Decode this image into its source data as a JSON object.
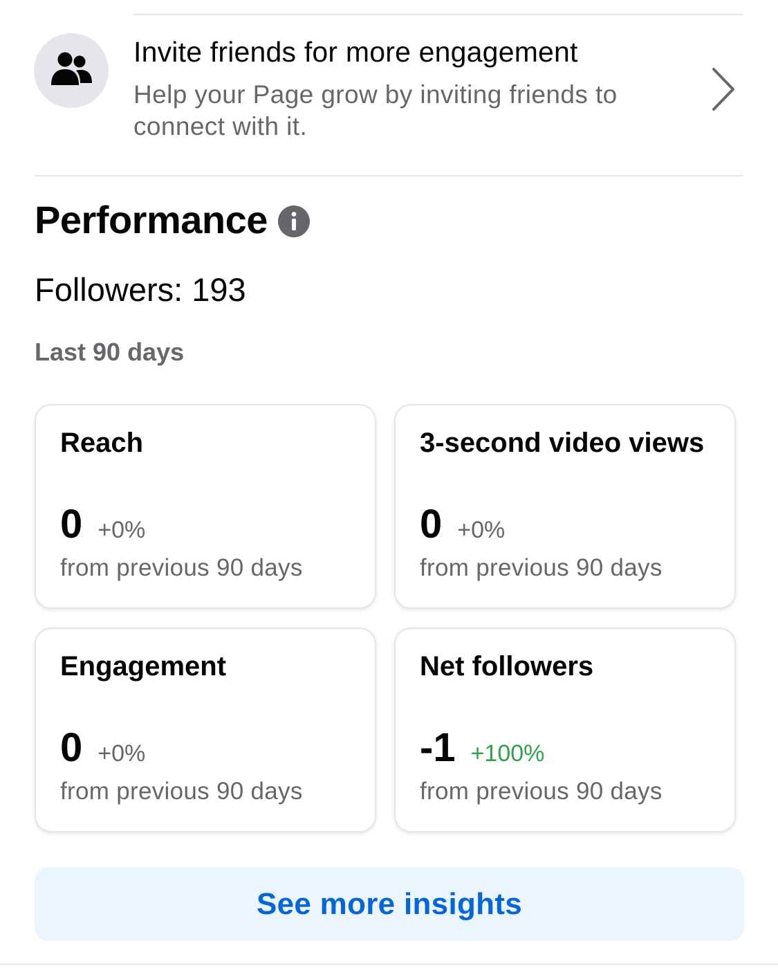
{
  "invite": {
    "title": "Invite friends for more engagement",
    "description": "Help your Page grow by inviting friends to connect with it.",
    "icon": "people-icon",
    "chevron_icon": "chevron-right-icon"
  },
  "performance": {
    "title": "Performance",
    "info_icon": "info-icon",
    "followers_label": "Followers: 193",
    "period_label": "Last 90 days"
  },
  "metrics": [
    {
      "title": "Reach",
      "value": "0",
      "change": "+0%",
      "change_positive": false,
      "subtitle": "from previous 90 days"
    },
    {
      "title": "3-second video views",
      "value": "0",
      "change": "+0%",
      "change_positive": false,
      "subtitle": "from previous 90 days"
    },
    {
      "title": "Engagement",
      "value": "0",
      "change": "+0%",
      "change_positive": false,
      "subtitle": "from previous 90 days"
    },
    {
      "title": "Net followers",
      "value": "-1",
      "change": "+100%",
      "change_positive": true,
      "subtitle": "from previous 90 days"
    }
  ],
  "cta": {
    "label": "See more insights"
  },
  "colors": {
    "primary_text": "#050505",
    "secondary_text": "#65676b",
    "positive": "#31a24c",
    "link_blue": "#0866d4",
    "cta_bg": "#ebf5ff",
    "divider": "#e4e6eb"
  }
}
